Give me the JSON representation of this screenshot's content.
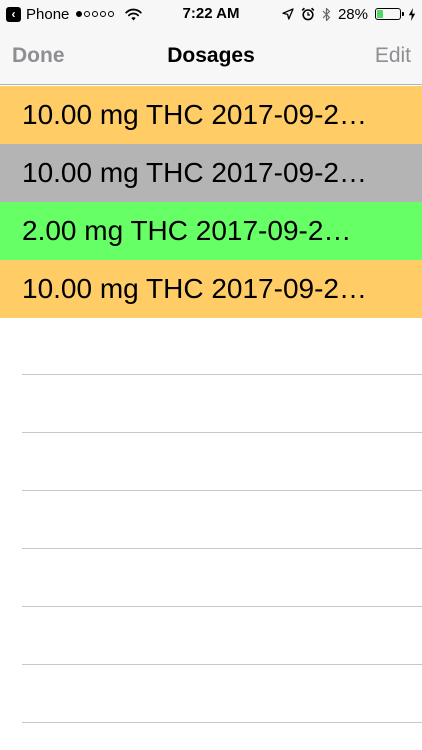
{
  "status_bar": {
    "back_label": "Phone",
    "signal_dots": [
      true,
      false,
      false,
      false,
      false
    ],
    "time": "7:22 AM",
    "battery_percent": "28%",
    "battery_level": 0.28,
    "icons": [
      "back-arrow-icon",
      "wifi-icon",
      "location-arrow-icon",
      "alarm-clock-icon",
      "bluetooth-icon",
      "battery-icon",
      "charging-bolt-icon"
    ]
  },
  "nav": {
    "left_label": "Done",
    "title": "Dosages",
    "right_label": "Edit"
  },
  "dosages": [
    {
      "text": "10.00 mg THC 2017-09-2…",
      "color": "#ffcc66"
    },
    {
      "text": "10.00 mg THC 2017-09-2…",
      "color": "#b4b4b4"
    },
    {
      "text": "2.00 mg THC 2017-09-2…",
      "color": "#66ff66"
    },
    {
      "text": "10.00 mg THC 2017-09-2…",
      "color": "#ffcc66"
    }
  ],
  "colors": {
    "nav_background": "#f7f7f7",
    "nav_button": "#8e8e93",
    "separator": "#c8c7cc",
    "battery_fill": "#4cd964"
  }
}
